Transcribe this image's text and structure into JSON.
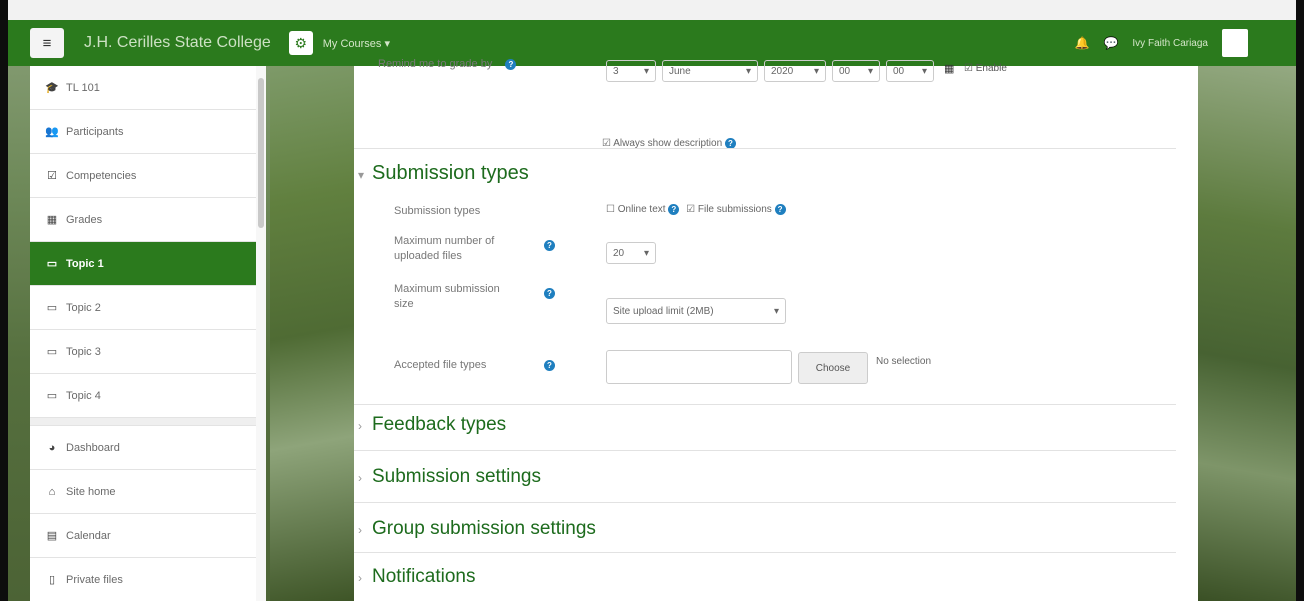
{
  "navbar": {
    "site_name": "J.H. Cerilles State College",
    "my_courses": "My Courses ▾",
    "username": "Ivy Faith Cariaga"
  },
  "sidebar": {
    "items": [
      {
        "label": "TL 101",
        "icon": "graduation-cap-icon",
        "glyph": "🎓"
      },
      {
        "label": "Participants",
        "icon": "users-icon",
        "glyph": "👥"
      },
      {
        "label": "Competencies",
        "icon": "checkbox-icon",
        "glyph": "☑"
      },
      {
        "label": "Grades",
        "icon": "table-icon",
        "glyph": "▦"
      },
      {
        "label": "Topic 1",
        "icon": "folder-icon",
        "glyph": "▭",
        "active": true
      },
      {
        "label": "Topic 2",
        "icon": "folder-icon",
        "glyph": "▭"
      },
      {
        "label": "Topic 3",
        "icon": "folder-icon",
        "glyph": "▭"
      },
      {
        "label": "Topic 4",
        "icon": "folder-icon",
        "glyph": "▭"
      },
      {
        "label": "Dashboard",
        "icon": "dashboard-icon",
        "glyph": "◕"
      },
      {
        "label": "Site home",
        "icon": "home-icon",
        "glyph": "⌂"
      },
      {
        "label": "Calendar",
        "icon": "calendar-icon",
        "glyph": "▤"
      },
      {
        "label": "Private files",
        "icon": "file-icon",
        "glyph": "▯"
      }
    ]
  },
  "date_row": {
    "label": "Remind me to grade by",
    "day": "3",
    "month": "June",
    "year": "2020",
    "hour": "00",
    "minute": "00",
    "enable_label": "Enable"
  },
  "always_show": "Always show description",
  "submission_types": {
    "title": "Submission types",
    "types_label": "Submission types",
    "online_text": "Online text",
    "file_submissions": "File submissions",
    "max_files_label": "Maximum number of uploaded files",
    "max_files_value": "20",
    "max_size_label": "Maximum submission size",
    "max_size_value": "Site upload limit (2MB)",
    "accepted_label": "Accepted file types",
    "choose_label": "Choose",
    "no_selection": "No selection"
  },
  "collapsed_sections": [
    "Feedback types",
    "Submission settings",
    "Group submission settings",
    "Notifications"
  ]
}
